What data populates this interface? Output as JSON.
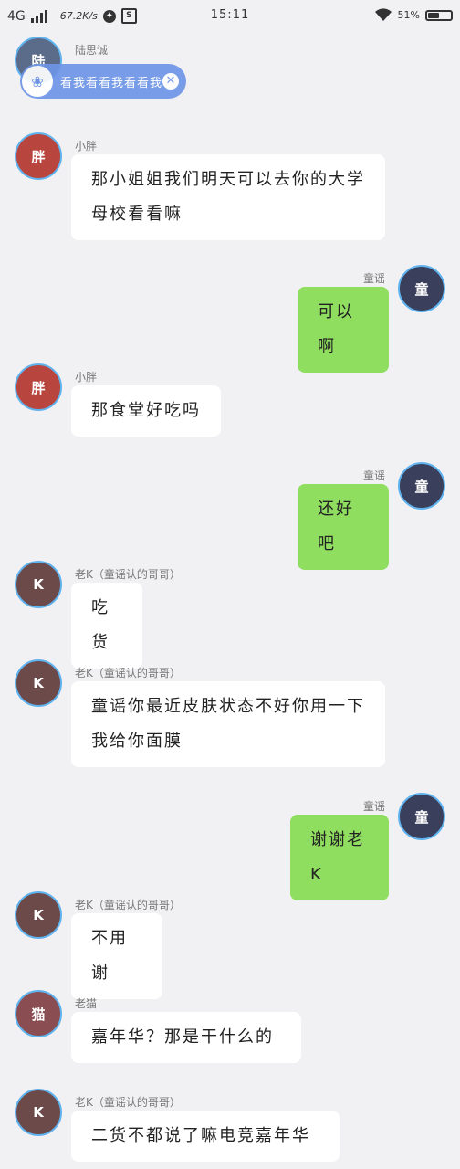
{
  "status_bar": {
    "network": "4G",
    "speed": "67.2K/s",
    "time": "15:11",
    "battery": "51%",
    "battery_level": 0.51
  },
  "overlay": {
    "text": "看我看看我看看我",
    "close_label": "✕"
  },
  "colors": {
    "background": "#f1f0f3",
    "bubble_incoming": "#ffffff",
    "bubble_outgoing": "#8fde5f",
    "avatar_ring": "#5fb3ef",
    "overlay_pill": "#6e95e6"
  },
  "messages": [
    {
      "side": "left",
      "sender": "陆思诚",
      "text": "",
      "avatar": "陆"
    },
    {
      "side": "left",
      "sender": "小胖",
      "text": "那小姐姐我们明天可以去你的大学母校看看嘛",
      "avatar": "胖"
    },
    {
      "side": "right",
      "sender": "童谣",
      "text": "可以啊",
      "avatar": "童"
    },
    {
      "side": "left",
      "sender": "小胖",
      "text": "那食堂好吃吗",
      "avatar": "胖"
    },
    {
      "side": "right",
      "sender": "童谣",
      "text": "还好吧",
      "avatar": "童"
    },
    {
      "side": "left",
      "sender": "老K（童谣认的哥哥）",
      "text": "吃货",
      "avatar": "K"
    },
    {
      "side": "left",
      "sender": "老K（童谣认的哥哥）",
      "text": "童谣你最近皮肤状态不好你用一下我给你面膜",
      "avatar": "K"
    },
    {
      "side": "right",
      "sender": "童谣",
      "text": "谢谢老K",
      "avatar": "童"
    },
    {
      "side": "left",
      "sender": "老K（童谣认的哥哥）",
      "text": "不用谢",
      "avatar": "K"
    },
    {
      "side": "left",
      "sender": "老猫",
      "text": "嘉年华？那是干什么的",
      "avatar": "猫"
    },
    {
      "side": "left",
      "sender": "老K（童谣认的哥哥）",
      "text": "二货不都说了嘛电竞嘉年华",
      "avatar": "K"
    }
  ]
}
